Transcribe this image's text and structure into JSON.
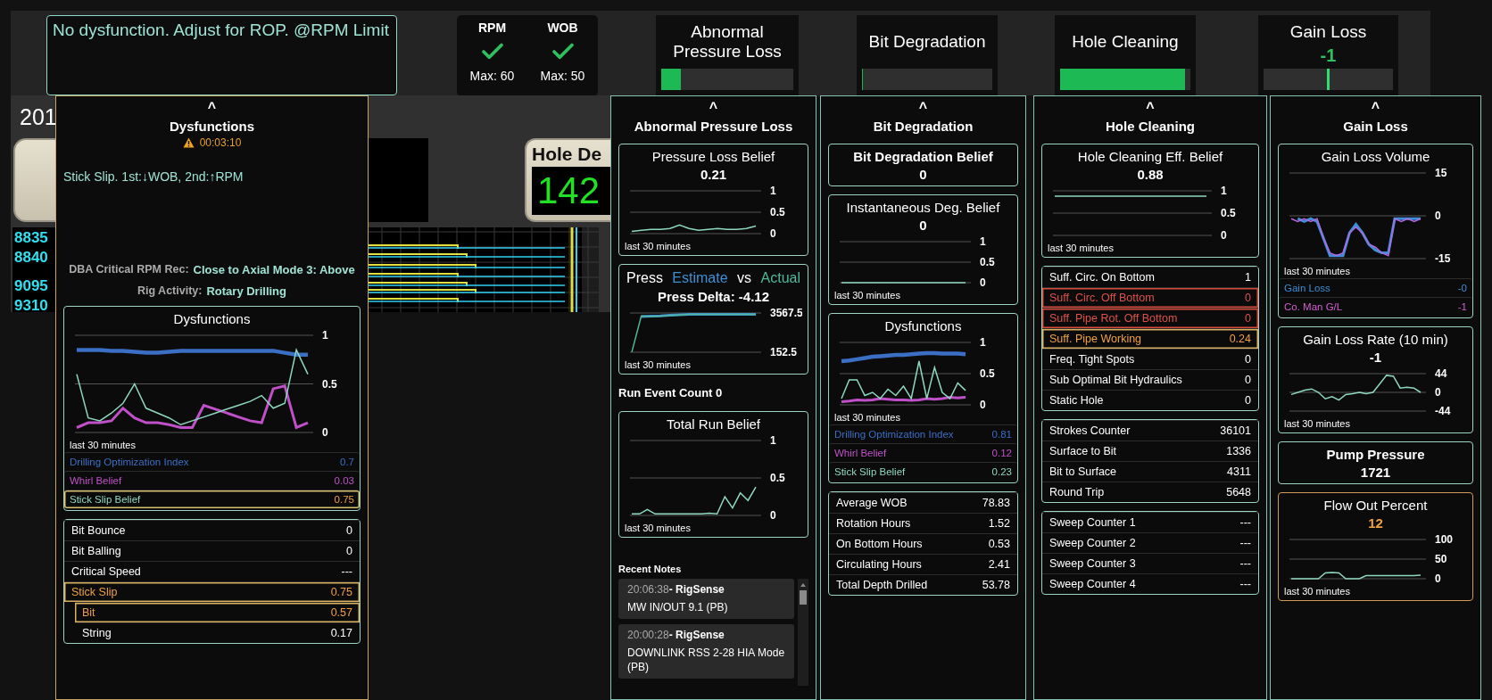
{
  "advisory": {
    "message": "No dysfunction. Adjust for ROP. @RPM Limit"
  },
  "limits": [
    {
      "label": "RPM",
      "ok": true,
      "max": "Max: 60"
    },
    {
      "label": "WOB",
      "ok": true,
      "max": "Max: 50"
    }
  ],
  "summary_tiles": [
    {
      "kind": "bar",
      "title": "Abnormal Pressure Loss",
      "level": 0.15
    },
    {
      "kind": "bar",
      "title": "Bit Degradation",
      "level": 0
    },
    {
      "kind": "bar",
      "title": "Hole Cleaning",
      "level": 0.96
    },
    {
      "kind": "marker",
      "title": "Gain Loss",
      "value": "-1",
      "level": 0.49
    }
  ],
  "background_view": {
    "heading": "201",
    "depth_label": "Hole De",
    "depth_value": "142",
    "depth_marks": [
      "8835",
      "8840",
      "9095",
      "9310"
    ]
  },
  "panels": [
    {
      "caret": "^",
      "title": "Dysfunctions",
      "highlighted": true,
      "sections": [
        {
          "kind": "alert",
          "timer": "00:03:10"
        },
        {
          "kind": "advice",
          "text": "Stick Slip. 1st:↓WOB, 2nd:↑RPM"
        },
        {
          "kind": "detail",
          "label": "DBA Critical RPM Rec:",
          "value": "Close to Axial Mode 3: Above"
        },
        {
          "kind": "detail",
          "label": "Rig Activity:",
          "value": "Rotary Drilling"
        },
        {
          "kind": "chart_card",
          "title": "Dysfunctions",
          "chart_data": {
            "type": "line",
            "ylim": [
              0,
              1
            ],
            "yticks": [
              0,
              0.5,
              1
            ],
            "series": [
              {
                "color": "#3a6fc4",
                "values": [
                  0.85,
                  0.85,
                  0.85,
                  0.84,
                  0.84,
                  0.83,
                  0.82,
                  0.82,
                  0.83,
                  0.84,
                  0.84,
                  0.84,
                  0.84,
                  0.84,
                  0.84,
                  0.84,
                  0.84,
                  0.84,
                  0.82,
                  0.8,
                  0.8
                ]
              },
              {
                "color": "#c050c8",
                "values": [
                  0.05,
                  0.1,
                  0.1,
                  0.12,
                  0.25,
                  0.15,
                  0.1,
                  0.1,
                  0.08,
                  0.05,
                  0.05,
                  0.28,
                  0.24,
                  0.2,
                  0.16,
                  0.12,
                  0.1,
                  0.45,
                  0.48,
                  0.05,
                  0.1
                ]
              },
              {
                "color": "#8fd8c0",
                "values": [
                  0.6,
                  0.15,
                  0.12,
                  0.2,
                  0.3,
                  0.5,
                  0.25,
                  0.2,
                  0.15,
                  0.08,
                  0.12,
                  0.16,
                  0.2,
                  0.24,
                  0.28,
                  0.32,
                  0.38,
                  0.25,
                  0.3,
                  0.85,
                  0.6
                ]
              }
            ]
          },
          "caption": "last 30 minutes",
          "legend": [
            {
              "label": "Drilling Optimization Index",
              "value": "0.7",
              "color": "#3a6fc4",
              "highlighted": false
            },
            {
              "label": "Whirl Belief",
              "value": "0.03",
              "color": "#c050c8",
              "highlighted": false
            },
            {
              "label": "Stick Slip Belief",
              "value": "0.75",
              "color": "#8fd8c0",
              "highlighted": true
            }
          ]
        },
        {
          "kind": "table",
          "rows": [
            {
              "label": "Bit Bounce",
              "value": "0",
              "kind": "normal"
            },
            {
              "label": "Bit Balling",
              "value": "0",
              "kind": "normal"
            },
            {
              "label": "Critical Speed",
              "value": "---",
              "kind": "normal"
            },
            {
              "label": "Stick Slip",
              "value": "0.75",
              "kind": "caution",
              "children": [
                {
                  "label": "Bit",
                  "value": "0.57",
                  "kind": "caution"
                },
                {
                  "label": "String",
                  "value": "0.17",
                  "kind": "normal"
                }
              ]
            }
          ]
        }
      ]
    },
    {
      "caret": "^",
      "title": "Abnormal Pressure Loss",
      "highlighted": false,
      "sections": [
        {
          "kind": "chart_card",
          "title": "Pressure Loss Belief",
          "value": "0.21",
          "chart_data": {
            "type": "line",
            "ylim": [
              0,
              1
            ],
            "yticks": [
              0,
              0.5,
              1
            ],
            "series": [
              {
                "color": "#8fd8c0",
                "values": [
                  0.05,
                  0.08,
                  0.1,
                  0.1,
                  0.12,
                  0.2,
                  0.12,
                  0.08,
                  0.1,
                  0.12,
                  0.1,
                  0.1,
                  0.12,
                  0.18
                ]
              }
            ]
          },
          "caption": "last 30 minutes"
        },
        {
          "kind": "compare_chart",
          "title": "Press",
          "estimate": "Estimate",
          "vs": "vs",
          "actual": "Actual",
          "value": "Press Delta: -4.12",
          "chart_data": {
            "type": "line",
            "ylim": [
              152.5,
              3567.5
            ],
            "yticks": [
              152.5,
              3567.5
            ],
            "series": [
              {
                "color": "#3d8fd6",
                "values": [
                  null,
                  3250,
                  3300,
                  3320,
                  3380,
                  3420,
                  3440,
                  3450,
                  3450,
                  3450,
                  3450,
                  3450,
                  3450,
                  3450
                ]
              },
              {
                "color": "#52b89a",
                "values": [
                  160,
                  3300,
                  3250,
                  3300,
                  3350,
                  3400,
                  3450,
                  3450,
                  3460,
                  3460,
                  3460,
                  3460,
                  3460,
                  3460
                ]
              }
            ]
          },
          "caption": "last 30 minutes"
        },
        {
          "kind": "text",
          "text": "Run Event Count 0"
        },
        {
          "kind": "chart_card",
          "title": "Total Run Belief",
          "chart_data": {
            "type": "line",
            "ylim": [
              0,
              1
            ],
            "yticks": [
              0,
              0.5,
              1
            ],
            "series": [
              {
                "color": "#8fd8c0",
                "values": [
                  0.02,
                  0.02,
                  0.08,
                  0.02,
                  0.02,
                  0.02,
                  0.02,
                  0.02,
                  0.02,
                  0.02,
                  0.03,
                  0.02,
                  0.25,
                  0.1,
                  0.3,
                  0.2,
                  0.38
                ]
              }
            ]
          },
          "caption": "last 30 minutes"
        },
        {
          "kind": "notes",
          "title": "Recent Notes",
          "items": [
            {
              "time": "20:06:38",
              "author": "- RigSense",
              "text": "MW IN/OUT 9.1 (PB)"
            },
            {
              "time": "20:00:28",
              "author": "- RigSense",
              "text": "DOWNLINK RSS 2-28 HIA Mode (PB)"
            }
          ]
        }
      ]
    },
    {
      "caret": "^",
      "title": "Bit Degradation",
      "highlighted": false,
      "sections": [
        {
          "kind": "stat_card",
          "title": "Bit Degradation Belief",
          "value": "0"
        },
        {
          "kind": "chart_card",
          "title": "Instantaneous Deg. Belief",
          "value": "0",
          "chart_data": {
            "type": "line",
            "ylim": [
              0,
              1
            ],
            "yticks": [
              0,
              0.5,
              1
            ],
            "series": [
              {
                "color": "#8fd8c0",
                "values": [
                  0,
                  0,
                  0,
                  0,
                  0,
                  0,
                  0,
                  0,
                  0,
                  0
                ]
              }
            ]
          },
          "caption": "last 30 minutes"
        },
        {
          "kind": "chart_card",
          "title": "Dysfunctions",
          "chart_data": {
            "type": "line",
            "ylim": [
              0,
              1
            ],
            "yticks": [
              0,
              0.5,
              1
            ],
            "series": [
              {
                "color": "#3a6fc4",
                "values": [
                  0.7,
                  0.71,
                  0.73,
                  0.75,
                  0.77,
                  0.78,
                  0.79,
                  0.8,
                  0.8,
                  0.81,
                  0.82,
                  0.83,
                  0.83,
                  0.82,
                  0.82,
                  0.82,
                  0.81
                ]
              },
              {
                "color": "#c050c8",
                "values": [
                  0.05,
                  0.06,
                  0.08,
                  0.07,
                  0.08,
                  0.1,
                  0.09,
                  0.08,
                  0.08,
                  0.07,
                  0.08,
                  0.1,
                  0.09,
                  0.1,
                  0.12,
                  0.11,
                  0.12
                ]
              },
              {
                "color": "#8fd8c0",
                "values": [
                  0.1,
                  0.4,
                  0.4,
                  0.15,
                  0.2,
                  0.1,
                  0.25,
                  0.15,
                  0.3,
                  0.1,
                  0.7,
                  0.1,
                  0.6,
                  0.2,
                  0.1,
                  0.35,
                  0.23
                ]
              }
            ]
          },
          "caption": "last 30 minutes",
          "legend": [
            {
              "label": "Drilling Optimization Index",
              "value": "0.81",
              "color": "#3a6fc4",
              "highlighted": false
            },
            {
              "label": "Whirl Belief",
              "value": "0.12",
              "color": "#c050c8",
              "highlighted": false
            },
            {
              "label": "Stick Slip Belief",
              "value": "0.23",
              "color": "#8fd8c0",
              "highlighted": false
            }
          ]
        },
        {
          "kind": "table",
          "rows": [
            {
              "label": "Average WOB",
              "value": "78.83",
              "kind": "normal"
            },
            {
              "label": "Rotation Hours",
              "value": "1.52",
              "kind": "normal"
            },
            {
              "label": "On Bottom Hours",
              "value": "0.53",
              "kind": "normal"
            },
            {
              "label": "Circulating Hours",
              "value": "2.41",
              "kind": "normal"
            },
            {
              "label": "Total Depth Drilled",
              "value": "53.78",
              "kind": "normal"
            }
          ]
        }
      ]
    },
    {
      "caret": "^",
      "title": "Hole Cleaning",
      "highlighted": false,
      "sections": [
        {
          "kind": "chart_card",
          "title": "Hole Cleaning Eff. Belief",
          "value": "0.88",
          "chart_data": {
            "type": "line",
            "ylim": [
              0,
              1
            ],
            "yticks": [
              0,
              0.5,
              1
            ],
            "series": [
              {
                "color": "#8fd8c0",
                "values": [
                  0.88,
                  0.88,
                  0.88,
                  0.88,
                  0.88,
                  0.88,
                  0.88,
                  0.88,
                  0.88,
                  0.88
                ]
              }
            ]
          },
          "caption": "last 30 minutes"
        },
        {
          "kind": "table",
          "rows": [
            {
              "label": "Suff. Circ. On Bottom",
              "value": "1",
              "kind": "normal"
            },
            {
              "label": "Suff. Circ. Off Bottom",
              "value": "0",
              "kind": "alarm"
            },
            {
              "label": "Suff. Pipe Rot. Off Bottom",
              "value": "0",
              "kind": "alarm"
            },
            {
              "label": "Suff. Pipe Working",
              "value": "0.24",
              "kind": "caution"
            },
            {
              "label": "Freq. Tight Spots",
              "value": "0",
              "kind": "normal"
            },
            {
              "label": "Sub Optimal Bit Hydraulics",
              "value": "0",
              "kind": "normal"
            },
            {
              "label": "Static Hole",
              "value": "0",
              "kind": "normal"
            }
          ]
        },
        {
          "kind": "table",
          "rows": [
            {
              "label": "Strokes Counter",
              "value": "36101",
              "kind": "normal"
            },
            {
              "label": "Surface to Bit",
              "value": "1336",
              "kind": "normal"
            },
            {
              "label": "Bit to Surface",
              "value": "4311",
              "kind": "normal"
            },
            {
              "label": "Round Trip",
              "value": "5648",
              "kind": "normal"
            }
          ]
        },
        {
          "kind": "table",
          "rows": [
            {
              "label": "Sweep Counter 1",
              "value": "---",
              "kind": "normal"
            },
            {
              "label": "Sweep Counter 2",
              "value": "---",
              "kind": "normal"
            },
            {
              "label": "Sweep Counter 3",
              "value": "---",
              "kind": "normal"
            },
            {
              "label": "Sweep Counter 4",
              "value": "---",
              "kind": "normal"
            }
          ]
        }
      ]
    },
    {
      "caret": "^",
      "title": "Gain Loss",
      "highlighted": false,
      "sections": [
        {
          "kind": "chart_card",
          "title": "Gain Loss Volume",
          "chart_data": {
            "type": "line",
            "ylim": [
              -15,
              15
            ],
            "yticks": [
              -15,
              0,
              15
            ],
            "series": [
              {
                "color": "#3d8fd6",
                "values": [
                  null,
                  -1,
                  -2,
                  -1,
                  -2,
                  -8,
                  -14,
                  -14,
                  -14,
                  -6,
                  -3,
                  -6,
                  -10,
                  -12,
                  -13,
                  -13,
                  -1,
                  -1,
                  -1,
                  -1,
                  -1
                ]
              },
              {
                "color": "#b068e0",
                "values": [
                  -1,
                  -2,
                  -1,
                  -2,
                  -1,
                  -8,
                  -13,
                  -14,
                  -13,
                  -6,
                  -4,
                  -6,
                  -10,
                  -11,
                  -13,
                  -14,
                  -1,
                  -2,
                  -1,
                  -2,
                  -1
                ]
              }
            ]
          },
          "caption": "last 30 minutes",
          "legend": [
            {
              "label": "Gain Loss",
              "value": "-0",
              "color": "#3d8fd6",
              "highlighted": false
            },
            {
              "label": "Co. Man G/L",
              "value": "-1",
              "color": "#d060d0",
              "highlighted": false
            }
          ]
        },
        {
          "kind": "chart_card",
          "title": "Gain Loss Rate (10 min)",
          "value": "-1",
          "chart_data": {
            "type": "line",
            "ylim": [
              -44,
              44
            ],
            "yticks": [
              -44,
              0,
              44
            ],
            "series": [
              {
                "color": "#8fd8c0",
                "values": [
                  -5,
                  0,
                  5,
                  8,
                  0,
                  -15,
                  -10,
                  -18,
                  -5,
                  -3,
                  0,
                  -3,
                  0,
                  20,
                  40,
                  38,
                  10,
                  12,
                  10,
                  0
                ]
              }
            ]
          },
          "caption": "last 30 minutes"
        },
        {
          "kind": "stat_card",
          "title": "Pump Pressure",
          "value": "1721"
        },
        {
          "kind": "chart_card",
          "title": "Flow Out Percent",
          "value": "12",
          "caution": true,
          "chart_data": {
            "type": "line",
            "ylim": [
              0,
              100
            ],
            "yticks": [
              0,
              50,
              100
            ],
            "series": [
              {
                "color": "#8fd8c0",
                "values": [
                  0,
                  0,
                  0,
                  0,
                  0,
                  15,
                  16,
                  15,
                  0,
                  0,
                  0,
                  8,
                  8,
                  8,
                  8,
                  8,
                  8,
                  8,
                  8,
                  9
                ]
              }
            ]
          },
          "caption": "last 30 minutes"
        }
      ]
    }
  ]
}
